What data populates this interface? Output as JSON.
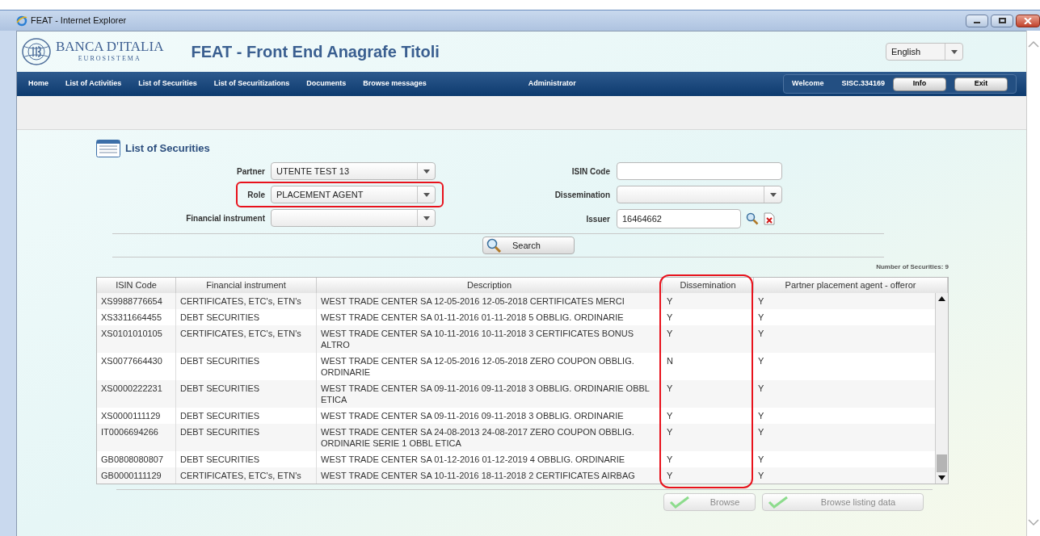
{
  "window": {
    "title": "FEAT - Internet Explorer"
  },
  "header": {
    "logo_name": "BANCA D'ITALIA",
    "logo_sub": "EUROSISTEMA",
    "app_title": "FEAT - Front End Anagrafe Titoli",
    "language": "English"
  },
  "nav": {
    "items": [
      "Home",
      "List of Activities",
      "List of Securities",
      "List of Securitizations",
      "Documents",
      "Browse messages"
    ],
    "role": "Administrator",
    "welcome": "Welcome",
    "user": "SISC.334169",
    "buttons": [
      "Info",
      "Exit"
    ]
  },
  "page": {
    "title": "List of Securities"
  },
  "filters_left": [
    {
      "label": "Partner",
      "kind": "select",
      "value": "UTENTE TEST 13",
      "highlighted": false
    },
    {
      "label": "Role",
      "kind": "select",
      "value": "PLACEMENT AGENT",
      "highlighted": true
    },
    {
      "label": "Financial instrument",
      "kind": "select",
      "highlighted": false
    }
  ],
  "filters_right": [
    {
      "label": "ISIN Code",
      "kind": "text"
    },
    {
      "label": "Dissemination",
      "kind": "select"
    },
    {
      "label": "Issuer",
      "kind": "lookup",
      "value": "16464662"
    }
  ],
  "search_button": "Search",
  "count": "Number of Securities: 9",
  "table": {
    "columns": [
      {
        "label": "ISIN Code",
        "highlighted": false
      },
      {
        "label": "Financial instrument",
        "highlighted": false
      },
      {
        "label": "Description",
        "highlighted": false
      },
      {
        "label": "Dissemination",
        "highlighted": true
      },
      {
        "label": "Partner placement agent - offeror",
        "highlighted": false
      }
    ],
    "rows": [
      [
        "XS9988776654",
        "CERTIFICATES, ETC's, ETN's",
        "WEST TRADE CENTER SA 12-05-2016 12-05-2018 CERTIFICATES MERCI",
        "Y",
        "Y"
      ],
      [
        "XS3311664455",
        "DEBT SECURITIES",
        "WEST TRADE CENTER SA 01-11-2016 01-11-2018 5 OBBLIG. ORDINARIE",
        "Y",
        "Y"
      ],
      [
        "XS0101010105",
        "CERTIFICATES, ETC's, ETN's",
        "WEST TRADE CENTER SA 10-11-2016 10-11-2018 3 CERTIFICATES BONUS ALTRO",
        "Y",
        "Y"
      ],
      [
        "XS0077664430",
        "DEBT SECURITIES",
        "WEST TRADE CENTER SA 12-05-2016 12-05-2018 ZERO COUPON OBBLIG. ORDINARIE",
        "N",
        "Y"
      ],
      [
        "XS0000222231",
        "DEBT SECURITIES",
        "WEST TRADE CENTER SA 09-11-2016 09-11-2018 3 OBBLIG. ORDINARIE OBBL ETICA",
        "Y",
        "Y"
      ],
      [
        "XS0000111129",
        "DEBT SECURITIES",
        "WEST TRADE CENTER SA 09-11-2016 09-11-2018 3 OBBLIG. ORDINARIE",
        "Y",
        "Y"
      ],
      [
        "IT0006694266",
        "DEBT SECURITIES",
        "WEST TRADE CENTER SA 24-08-2013 24-08-2017 ZERO COUPON OBBLIG. ORDINARIE SERIE 1 OBBL ETICA",
        "Y",
        "Y"
      ],
      [
        "GB0808080807",
        "DEBT SECURITIES",
        "WEST TRADE CENTER SA 01-12-2016 01-12-2019 4 OBBLIG. ORDINARIE",
        "Y",
        "Y"
      ],
      [
        "GB0000111129",
        "CERTIFICATES, ETC's, ETN's",
        "WEST TRADE CENTER SA 10-11-2016 18-11-2018 2 CERTIFICATES AIRBAG",
        "Y",
        "Y"
      ]
    ]
  },
  "actions": [
    {
      "label": "Browse",
      "disabled": true
    },
    {
      "label": "Browse listing data",
      "disabled": true
    }
  ]
}
